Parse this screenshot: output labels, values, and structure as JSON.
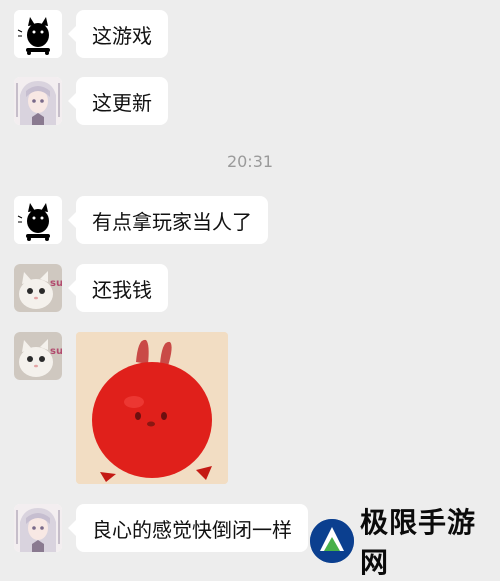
{
  "timestamp": "20:31",
  "messages": [
    {
      "avatar": "black-cat-icon",
      "text": "这游戏"
    },
    {
      "avatar": "anime-girl-icon",
      "text": "这更新"
    },
    {
      "avatar": "black-cat-icon",
      "text": "有点拿玩家当人了"
    },
    {
      "avatar": "white-cat-icon",
      "text": "还我钱"
    },
    {
      "avatar": "white-cat-icon",
      "sticker": "red-rabbit-sticker"
    },
    {
      "avatar": "anime-girl-icon",
      "text": "良心的感觉快倒闭一样"
    }
  ],
  "avatar_labels": {
    "white_cat": "sup"
  },
  "watermark": {
    "text": "极限手游网"
  },
  "colors": {
    "background": "#ededed",
    "bubble": "#ffffff",
    "timestamp": "#9a9a9a",
    "sticker_red": "#e0201b"
  }
}
